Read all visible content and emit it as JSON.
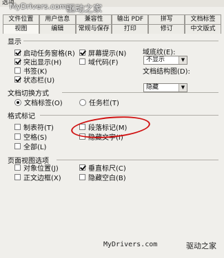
{
  "dialog": {
    "title": "选项"
  },
  "tabs_row1": [
    "文件位置",
    "用户信息",
    "兼容性",
    "输出 PDF",
    "拼写",
    "文档标签"
  ],
  "tabs_row2": [
    "视图",
    "编辑",
    "常规与保存",
    "打印",
    "修订",
    "中文版式"
  ],
  "watermark_top": {
    "site": "MyDrivers.com",
    "name": "驱动之家"
  },
  "display": {
    "label": "显示",
    "startup_pane": "启动任务窗格(R)",
    "highlight": "突出显示(H)",
    "bookmarks": "书签(K)",
    "statusbar": "状态栏(U)",
    "screen_tips": "屏幕提示(N)",
    "field_codes": "域代码(F)",
    "field_shading_label": "域底纹(E):",
    "field_shading_value": "不显示",
    "doc_map_label": "文档结构图(D):",
    "doc_map_value": "隐藏"
  },
  "doc_switch": {
    "label": "文档切换方式",
    "doc_tab": "文档标签(O)",
    "taskbar": "任务栏(T)"
  },
  "format_marks": {
    "label": "格式标记",
    "tab_char": "制表符(T)",
    "paragraph": "段落标记(M)",
    "spaces": "空格(S)",
    "hidden_text": "隐藏文字(I)",
    "all": "全部(L)"
  },
  "page_view": {
    "label": "页面视图选项",
    "object_position": "对象位置(J)",
    "vertical_ruler": "垂直标尺(C)",
    "text_border": "正文边框(X)",
    "hide_whitespace": "隐藏空白(B)"
  },
  "watermark_bottom": {
    "site": "MyDrivers.com",
    "name": "驱动之家"
  }
}
